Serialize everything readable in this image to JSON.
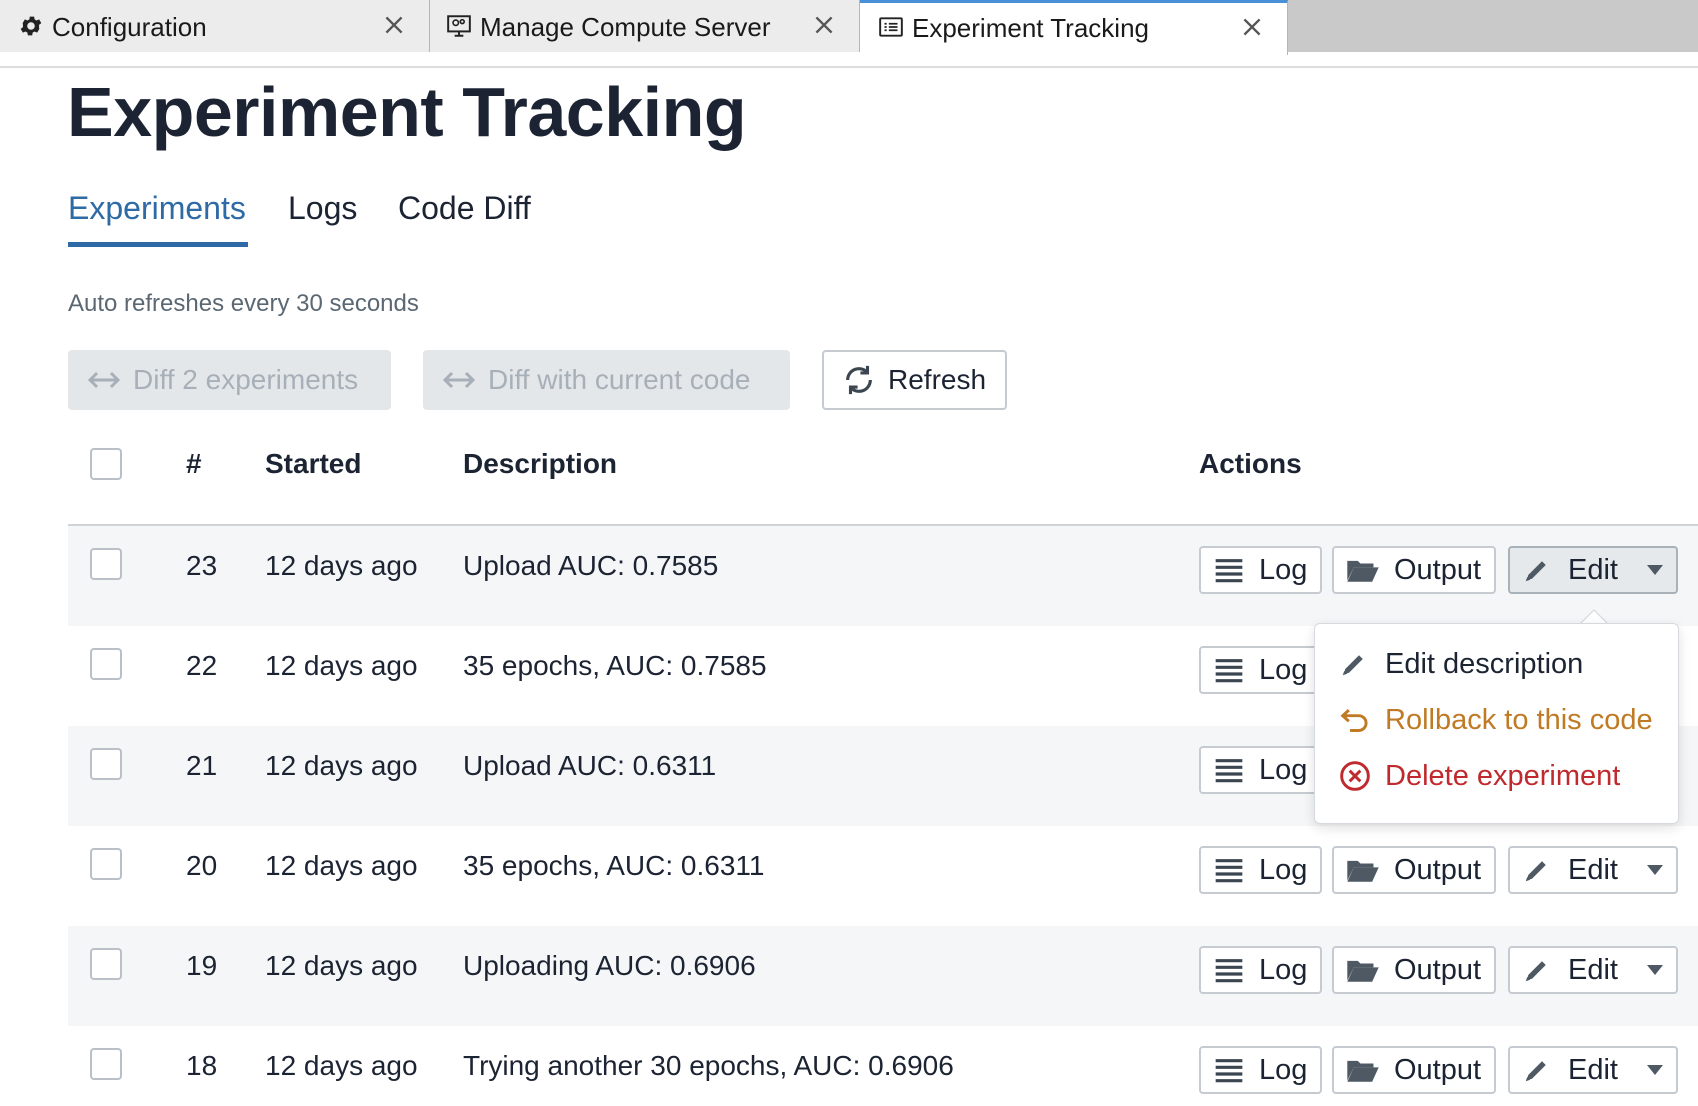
{
  "tabs": [
    {
      "label": "Configuration",
      "icon": "gear-icon",
      "active": false
    },
    {
      "label": "Manage Compute Server",
      "icon": "server-monitor-icon",
      "active": false
    },
    {
      "label": "Experiment Tracking",
      "icon": "list-icon",
      "active": true
    }
  ],
  "page": {
    "title": "Experiment Tracking",
    "subtabs": [
      "Experiments",
      "Logs",
      "Code Diff"
    ],
    "active_subtab": "Experiments",
    "refresh_note": "Auto refreshes every 30 seconds"
  },
  "toolbar": {
    "diff_two": "Diff 2 experiments",
    "diff_current": "Diff with current code",
    "refresh": "Refresh"
  },
  "table": {
    "headers": {
      "number": "#",
      "started": "Started",
      "description": "Description",
      "actions": "Actions"
    },
    "rows": [
      {
        "number": "23",
        "started": "12 days ago",
        "description": "Upload AUC: 0.7585"
      },
      {
        "number": "22",
        "started": "12 days ago",
        "description": "35 epochs, AUC: 0.7585"
      },
      {
        "number": "21",
        "started": "12 days ago",
        "description": "Upload AUC: 0.6311"
      },
      {
        "number": "20",
        "started": "12 days ago",
        "description": "35 epochs, AUC: 0.6311"
      },
      {
        "number": "19",
        "started": "12 days ago",
        "description": "Uploading AUC: 0.6906"
      },
      {
        "number": "18",
        "started": "12 days ago",
        "description": "Trying another 30 epochs, AUC: 0.6906"
      }
    ],
    "actions": {
      "log": "Log",
      "output": "Output",
      "edit": "Edit"
    }
  },
  "edit_menu": {
    "edit_description": "Edit description",
    "rollback": "Rollback to this code",
    "delete": "Delete experiment"
  },
  "colors": {
    "accent": "#2e6aa6",
    "rollback": "#c07a25",
    "delete": "#c0292d",
    "row_alt": "#f5f6f7"
  }
}
